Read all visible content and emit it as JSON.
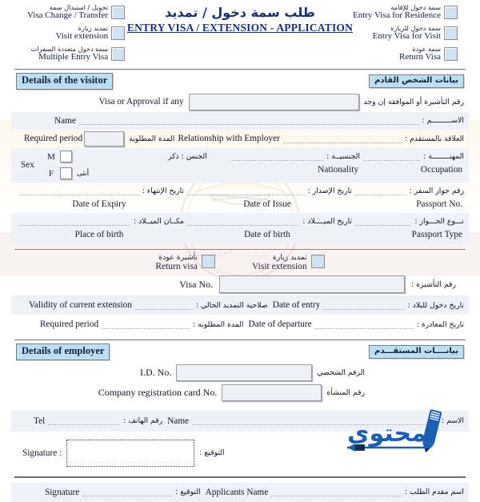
{
  "document": {
    "title_ar": "طلب سمة دخول / تمديد",
    "title_en": "ENTRY VISA / EXTENSION - APPLICATION"
  },
  "top_checkboxes": {
    "left": [
      {
        "ar": "تحويل / استبدال سمة",
        "en": "Visa Change / Transfer"
      },
      {
        "ar": "تمديد زيارة",
        "en": "Visit extension"
      },
      {
        "ar": "سمة دخول متعددة السفرات",
        "en": "Multiple Entry Visa"
      }
    ],
    "right": [
      {
        "ar": "سمة دخول للإقامة",
        "en": "Entry Visa for Residence"
      },
      {
        "ar": "سمة دخول للزيارة",
        "en": "Entry Visa for Visit"
      },
      {
        "ar": "سمة عودة",
        "en": "Return Visa"
      }
    ]
  },
  "visitor_section": {
    "badge_en": "Details of the visitor",
    "badge_ar": "بيانات الشخص القادم",
    "visa_approval": {
      "en": "Visa or Approval if any",
      "ar": "رقم التأشيرة أو الموافقة إن وجد",
      "value": ""
    },
    "name": {
      "en": "Name",
      "ar": "الاســـــــــم :",
      "value": ""
    },
    "required_period": {
      "en": "Required period",
      "ar": "المدة المطلوبة",
      "value": ""
    },
    "relationship": {
      "en": "Relationship with Employer",
      "ar": "العلاقة بالمستقدم :",
      "value": ""
    },
    "sex": {
      "en": "Sex",
      "ar": "الجنس : ذكر",
      "male_letter": "M",
      "female_letter": "F",
      "female_ar": "أنثى"
    },
    "nationality": {
      "en": "Nationality",
      "ar": "الجنسيــة :",
      "value": ""
    },
    "occupation": {
      "en": "Occupation",
      "ar": "المهنــــــــة :",
      "value": ""
    },
    "passport_no": {
      "en": "Passport No.",
      "ar": "رقم جواز السفر :",
      "value": ""
    },
    "date_of_issue": {
      "en": "Date of Issue",
      "ar": "تاريخ الإصدار :",
      "value": ""
    },
    "date_of_expiry": {
      "en": "Date of Expiry",
      "ar": "تاريخ الإنتهاء :",
      "value": ""
    },
    "passport_type": {
      "en": "Passport Type",
      "ar": "نـــوع الجـــواز :",
      "value": ""
    },
    "date_of_birth": {
      "en": "Date of birth",
      "ar": "تاريخ الميــــلاد :",
      "value": ""
    },
    "place_of_birth": {
      "en": "Place of birth",
      "ar": "مكــان الميــلاد :",
      "value": ""
    }
  },
  "extension_section": {
    "visit_extension": {
      "ar": "تمديد زيارة",
      "en": "Visit extension"
    },
    "return_visa": {
      "ar": "تأشيرة عودة",
      "en": "Return visa"
    },
    "visa_no": {
      "en": "Visa No.",
      "ar": "رقم التأشيرة :",
      "value": ""
    },
    "date_of_entry": {
      "en": "Date of entry",
      "ar": "تاريخ دخول للبلاد :",
      "value": ""
    },
    "validity_current_extension": {
      "en": "Validity of current extension",
      "ar": "صلاحية التمديد الحالي :",
      "value": ""
    },
    "date_of_departure": {
      "en": "Date of departure",
      "ar": "تاريخ المغادرة :",
      "value": ""
    },
    "required_period": {
      "en": "Required period",
      "ar": "المدة المطلوبة :",
      "value": ""
    }
  },
  "employer_section": {
    "badge_en": "Details of employer",
    "badge_ar": "بيانــــات المستقـــدم",
    "id_no": {
      "en": "I.D. No.",
      "ar": "الرقم الشخصي",
      "value": ""
    },
    "company_reg_card": {
      "en": "Company registration card No.",
      "ar": "رقم المنشأة",
      "value": ""
    },
    "name": {
      "en": "Name",
      "ar": "الاسم :",
      "value": ""
    },
    "tel": {
      "en": "Tel",
      "ar": "رقم الهاتف :",
      "value": ""
    },
    "signature": {
      "en": "Signature :",
      "ar": "التوقيع :",
      "value": ""
    }
  },
  "footer": {
    "applicants_name": {
      "en": "Applicants Name",
      "ar": "اسم مقدم الطلب :",
      "value": ""
    },
    "signature": {
      "en": "Signature",
      "ar": "التوقيع :",
      "value": ""
    }
  },
  "branding": {
    "logo_text_ar": "محتوى"
  },
  "colors": {
    "title_blue": "#16307a",
    "badge_fill": "#bcdff1",
    "checkbox_fill": "#cfe2f3",
    "input_fill": "#eef0f8",
    "logo_blue": "#1a5fb4",
    "rule_gray": "#707070"
  }
}
